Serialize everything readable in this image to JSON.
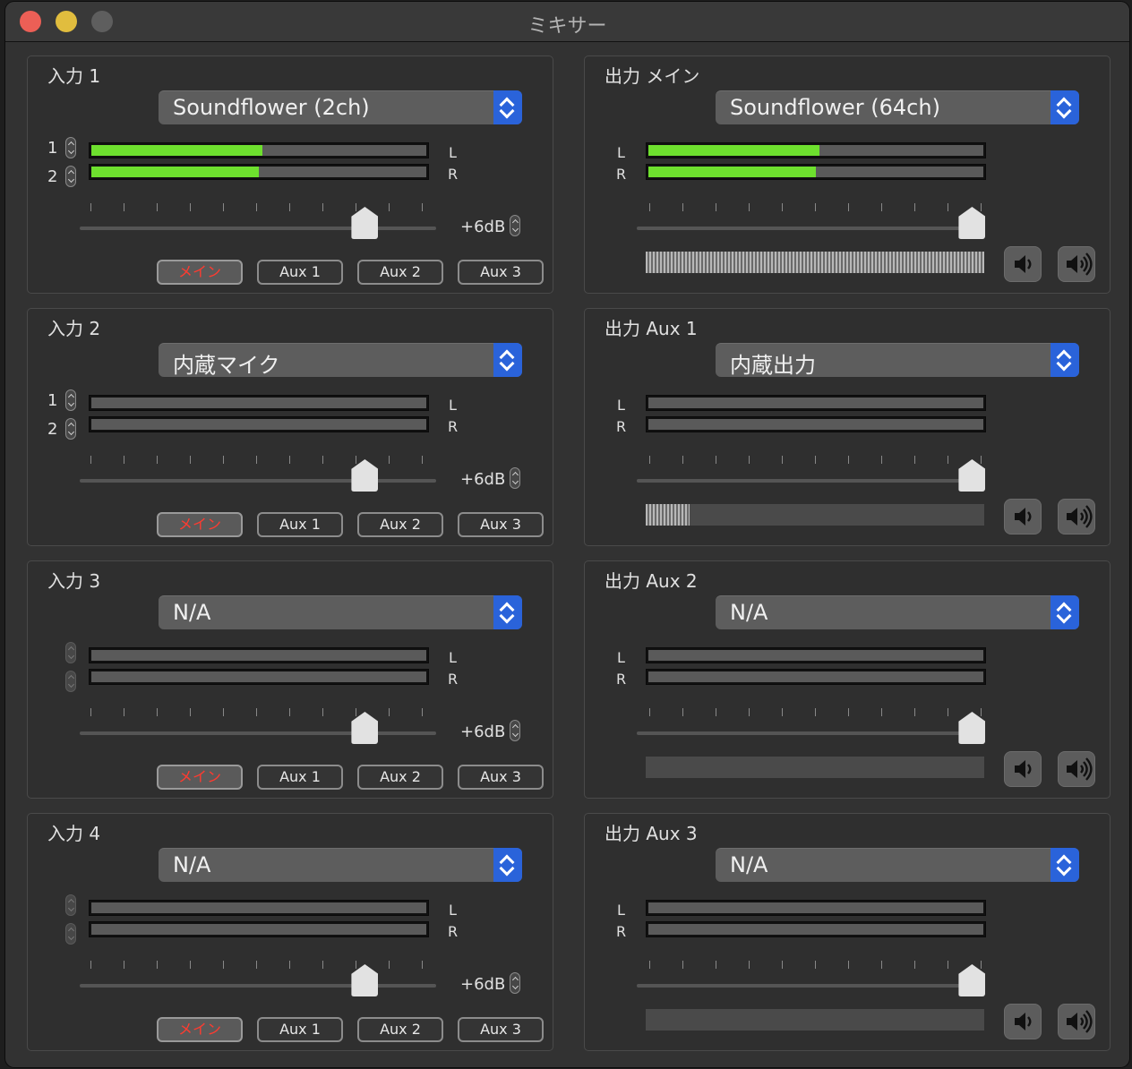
{
  "window": {
    "title": "ミキサー"
  },
  "inputs": [
    {
      "title": "入力 1",
      "device": "Soundflower (2ch)",
      "ch1_label": "1",
      "ch2_label": "2",
      "channels_enabled": true,
      "meter_left": 0.51,
      "meter_right": 0.5,
      "left_label": "L",
      "right_label": "R",
      "gain_label": "+6dB",
      "gain_position": 0.8,
      "routes": [
        {
          "label": "メイン",
          "on": true
        },
        {
          "label": "Aux 1",
          "on": false
        },
        {
          "label": "Aux 2",
          "on": false
        },
        {
          "label": "Aux 3",
          "on": false
        }
      ]
    },
    {
      "title": "入力 2",
      "device": "内蔵マイク",
      "ch1_label": "1",
      "ch2_label": "2",
      "channels_enabled": true,
      "meter_left": 0,
      "meter_right": 0,
      "left_label": "L",
      "right_label": "R",
      "gain_label": "+6dB",
      "gain_position": 0.8,
      "routes": [
        {
          "label": "メイン",
          "on": true
        },
        {
          "label": "Aux 1",
          "on": false
        },
        {
          "label": "Aux 2",
          "on": false
        },
        {
          "label": "Aux 3",
          "on": false
        }
      ]
    },
    {
      "title": "入力 3",
      "device": "N/A",
      "ch1_label": "",
      "ch2_label": "",
      "channels_enabled": false,
      "meter_left": 0,
      "meter_right": 0,
      "left_label": "L",
      "right_label": "R",
      "gain_label": "+6dB",
      "gain_position": 0.8,
      "routes": [
        {
          "label": "メイン",
          "on": true
        },
        {
          "label": "Aux 1",
          "on": false
        },
        {
          "label": "Aux 2",
          "on": false
        },
        {
          "label": "Aux 3",
          "on": false
        }
      ]
    },
    {
      "title": "入力 4",
      "device": "N/A",
      "ch1_label": "",
      "ch2_label": "",
      "channels_enabled": false,
      "meter_left": 0,
      "meter_right": 0,
      "left_label": "L",
      "right_label": "R",
      "gain_label": "+6dB",
      "gain_position": 0.8,
      "routes": [
        {
          "label": "メイン",
          "on": true
        },
        {
          "label": "Aux 1",
          "on": false
        },
        {
          "label": "Aux 2",
          "on": false
        },
        {
          "label": "Aux 3",
          "on": false
        }
      ]
    }
  ],
  "outputs": [
    {
      "title": "出力 メイン",
      "device": "Soundflower (64ch)",
      "meter_left": 0.51,
      "meter_right": 0.5,
      "left_label": "L",
      "right_label": "R",
      "gain_position": 0.97,
      "level": 1.0
    },
    {
      "title": "出力 Aux 1",
      "device": "内蔵出力",
      "meter_left": 0,
      "meter_right": 0,
      "left_label": "L",
      "right_label": "R",
      "gain_position": 0.97,
      "level": 0.13
    },
    {
      "title": "出力 Aux 2",
      "device": "N/A",
      "meter_left": 0,
      "meter_right": 0,
      "left_label": "L",
      "right_label": "R",
      "gain_position": 0.97,
      "level": 0
    },
    {
      "title": "出力 Aux 3",
      "device": "N/A",
      "meter_left": 0,
      "meter_right": 0,
      "left_label": "L",
      "right_label": "R",
      "gain_position": 0.97,
      "level": 0
    }
  ],
  "colors": {
    "meter_green": "#6ee02e",
    "select_blue": "#2a63da",
    "route_on_text": "#ff3b30"
  },
  "icons": {
    "speaker_low": "speaker-low-icon",
    "speaker_high": "speaker-high-icon"
  }
}
